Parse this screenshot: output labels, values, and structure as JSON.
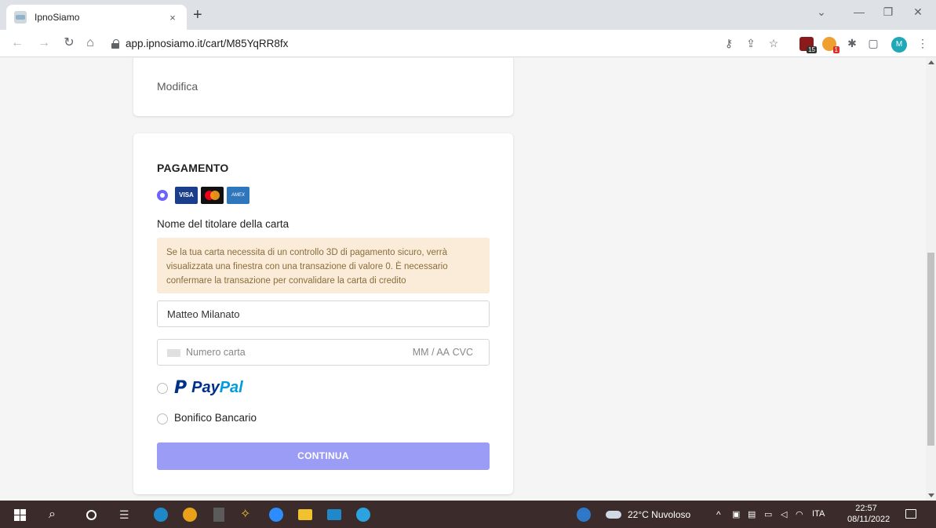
{
  "browser": {
    "tab_title": "IpnoSiamo",
    "tab_close": "×",
    "new_tab": "+",
    "url": "app.ipnosiamo.it/cart/M85YqRR8fx",
    "profile_initial": "M",
    "ext_badge_1": "15",
    "ext_badge_2": "1",
    "icons": [
      "back-icon",
      "forward-icon",
      "reload-icon",
      "home-icon",
      "key-icon",
      "share-icon",
      "star-icon",
      "puzzle-icon",
      "sidepanel-icon",
      "menu-icon"
    ]
  },
  "page": {
    "modifica": "Modifica",
    "payment": {
      "title": "PAGAMENTO",
      "card_logos": [
        "VISA",
        "AMEX"
      ],
      "holder_label": "Nome del titolare della carta",
      "notice": "Se la tua carta necessita di un controllo 3D di pagamento sicuro, verrà visualizzata una finestra con una transazione di valore 0. È necessario confermare la transazione per convalidare la carta di credito",
      "holder_value": "Matteo Milanato",
      "card_number_placeholder": "Numero carta",
      "expiry_placeholder": "MM / AA",
      "cvc_placeholder": "CVC",
      "paypal_pay": "Pay",
      "paypal_pal": "Pal",
      "bonifico": "Bonifico Bancario",
      "continue": "CONTINUA",
      "selected_method": "card"
    },
    "colors": {
      "accent": "#6c63ff",
      "button": "#9b9cf6",
      "notice_bg": "#fbecd9",
      "notice_text": "#8a6d3b",
      "paypal_dark": "#003087",
      "paypal_light": "#009cde"
    }
  },
  "taskbar": {
    "weather": "22°C Nuvoloso",
    "language": "ITA",
    "time": "22:57",
    "date": "08/11/2022"
  }
}
